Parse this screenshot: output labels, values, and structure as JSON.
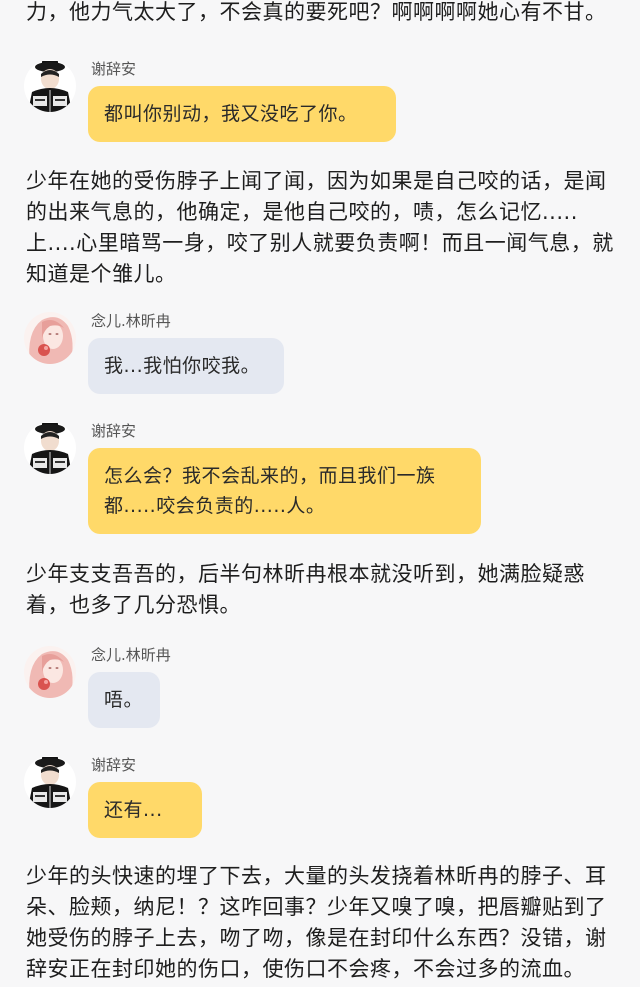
{
  "narrations": [
    "力，他力气太大了，不会真的要死吧？啊啊啊啊她心有不甘。",
    "少年在她的受伤脖子上闻了闻，因为如果是自己咬的话，是闻的出来气息的，他确定，是他自己咬的，啧，怎么记忆.....上....心里暗骂一身，咬了别人就要负责啊！而且一闻气息，就知道是个雏儿。",
    "少年支支吾吾的，后半句林昕冉根本就没听到，她满脸疑惑着，也多了几分恐惧。",
    "少年的头快速的埋了下去，大量的头发挠着林昕冉的脖子、耳朵、脸颊，纳尼！？这咋回事？少年又嗅了嗅，把唇瓣贴到了她受伤的脖子上去，吻了吻，像是在封印什么东西？没错，谢辞安正在封印她的伤口，使伤口不会疼，不会过多的流血。"
  ],
  "messages": [
    {
      "sender": "谢辞安",
      "text": "都叫你别动，我又没吃了你。",
      "avatar_icon": "boy-avatar-icon",
      "bubble_color": "#ffd969"
    },
    {
      "sender": "念儿.林昕冉",
      "text": "我...我怕你咬我。",
      "avatar_icon": "girl-avatar-icon",
      "bubble_color": "#e4e8f1"
    },
    {
      "sender": "谢辞安",
      "text": "怎么会？我不会乱来的，而且我们一族都.....咬会负责的.....人。",
      "avatar_icon": "boy-avatar-icon",
      "bubble_color": "#ffd969"
    },
    {
      "sender": "念儿.林昕冉",
      "text": "唔。",
      "avatar_icon": "girl-avatar-icon",
      "bubble_color": "#e4e8f1"
    },
    {
      "sender": "谢辞安",
      "text": "还有...",
      "avatar_icon": "boy-avatar-icon",
      "bubble_color": "#ffd969"
    }
  ]
}
